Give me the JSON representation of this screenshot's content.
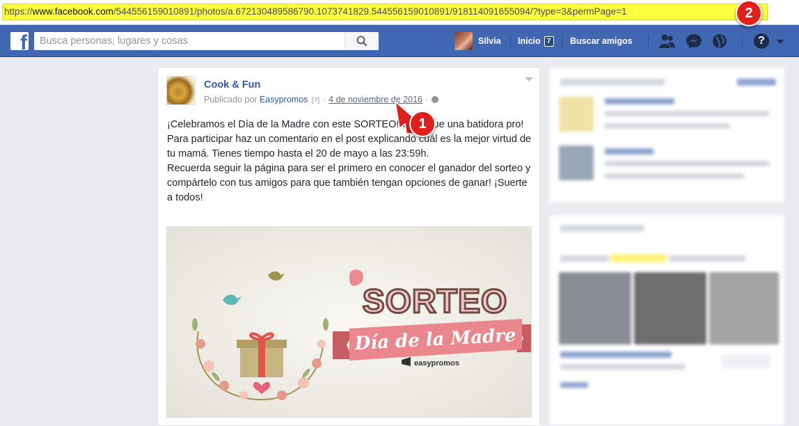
{
  "browser": {
    "url_proto": "https://",
    "url_domain": "www.facebook.com",
    "url_path": "/544556159010891/photos/a.672130489586790.1073741829.544556159010891/918114091655094/?type=3&permPage=1"
  },
  "topbar": {
    "search_placeholder": "Busca personas, lugares y cosas",
    "profile_name": "Sílvia",
    "home_label": "Inicio",
    "home_count": "7",
    "find_friends_label": "Buscar amigos",
    "help_glyph": "?",
    "colors": {
      "bar": "#4267b2",
      "dark": "#1c2b4a"
    },
    "icons": [
      "facebook-logo-icon",
      "search-icon",
      "friend-requests-icon",
      "messenger-icon",
      "notifications-globe-icon",
      "help-icon",
      "caret-down-icon"
    ]
  },
  "post": {
    "page_name": "Cook & Fun",
    "published_by_prefix": "Publicado por",
    "publisher": "Easypromos",
    "help_mark": "[?]",
    "separator": "·",
    "date": "4 de noviembre de 2016",
    "paragraphs": [
      "¡Celebramos el Día de la Madre con este SORTEO! Consigue una batidora pro!",
      "Para participar haz un comentario en el post explicando cuál es la mejor virtud de tu mamá. Tienes tiempo hasta el 20 de mayo a las 23:59h.",
      "Recuerda seguir la página para ser el primero en conocer el ganador del sorteo y compártelo con tus amigos para que también tengan opciones de ganar! ¡Suerte a todos!"
    ],
    "image": {
      "title": "SORTEO",
      "ribbon": "Día de la Madre",
      "brand": "easypromos"
    }
  },
  "annotations": {
    "marker_1": "1",
    "marker_2": "2",
    "color": "#e0211b"
  }
}
